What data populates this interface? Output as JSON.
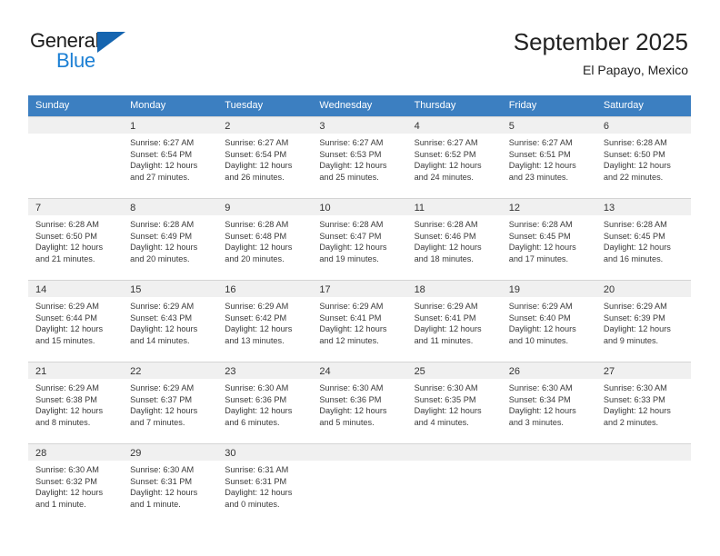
{
  "brand": {
    "name_top": "General",
    "name_bottom": "Blue",
    "triangle_color": "#1565b0",
    "blue_color": "#1b7fd4"
  },
  "header": {
    "title": "September 2025",
    "subtitle": "El Papayo, Mexico"
  },
  "calendar": {
    "header_bg": "#3c7fc1",
    "daynum_bg": "#f0f0f0",
    "weekdays": [
      "Sunday",
      "Monday",
      "Tuesday",
      "Wednesday",
      "Thursday",
      "Friday",
      "Saturday"
    ],
    "weeks": [
      [
        {
          "day": "",
          "empty": true
        },
        {
          "day": "1",
          "sunrise": "Sunrise: 6:27 AM",
          "sunset": "Sunset: 6:54 PM",
          "daylight1": "Daylight: 12 hours",
          "daylight2": "and 27 minutes."
        },
        {
          "day": "2",
          "sunrise": "Sunrise: 6:27 AM",
          "sunset": "Sunset: 6:54 PM",
          "daylight1": "Daylight: 12 hours",
          "daylight2": "and 26 minutes."
        },
        {
          "day": "3",
          "sunrise": "Sunrise: 6:27 AM",
          "sunset": "Sunset: 6:53 PM",
          "daylight1": "Daylight: 12 hours",
          "daylight2": "and 25 minutes."
        },
        {
          "day": "4",
          "sunrise": "Sunrise: 6:27 AM",
          "sunset": "Sunset: 6:52 PM",
          "daylight1": "Daylight: 12 hours",
          "daylight2": "and 24 minutes."
        },
        {
          "day": "5",
          "sunrise": "Sunrise: 6:27 AM",
          "sunset": "Sunset: 6:51 PM",
          "daylight1": "Daylight: 12 hours",
          "daylight2": "and 23 minutes."
        },
        {
          "day": "6",
          "sunrise": "Sunrise: 6:28 AM",
          "sunset": "Sunset: 6:50 PM",
          "daylight1": "Daylight: 12 hours",
          "daylight2": "and 22 minutes."
        }
      ],
      [
        {
          "day": "7",
          "sunrise": "Sunrise: 6:28 AM",
          "sunset": "Sunset: 6:50 PM",
          "daylight1": "Daylight: 12 hours",
          "daylight2": "and 21 minutes."
        },
        {
          "day": "8",
          "sunrise": "Sunrise: 6:28 AM",
          "sunset": "Sunset: 6:49 PM",
          "daylight1": "Daylight: 12 hours",
          "daylight2": "and 20 minutes."
        },
        {
          "day": "9",
          "sunrise": "Sunrise: 6:28 AM",
          "sunset": "Sunset: 6:48 PM",
          "daylight1": "Daylight: 12 hours",
          "daylight2": "and 20 minutes."
        },
        {
          "day": "10",
          "sunrise": "Sunrise: 6:28 AM",
          "sunset": "Sunset: 6:47 PM",
          "daylight1": "Daylight: 12 hours",
          "daylight2": "and 19 minutes."
        },
        {
          "day": "11",
          "sunrise": "Sunrise: 6:28 AM",
          "sunset": "Sunset: 6:46 PM",
          "daylight1": "Daylight: 12 hours",
          "daylight2": "and 18 minutes."
        },
        {
          "day": "12",
          "sunrise": "Sunrise: 6:28 AM",
          "sunset": "Sunset: 6:45 PM",
          "daylight1": "Daylight: 12 hours",
          "daylight2": "and 17 minutes."
        },
        {
          "day": "13",
          "sunrise": "Sunrise: 6:28 AM",
          "sunset": "Sunset: 6:45 PM",
          "daylight1": "Daylight: 12 hours",
          "daylight2": "and 16 minutes."
        }
      ],
      [
        {
          "day": "14",
          "sunrise": "Sunrise: 6:29 AM",
          "sunset": "Sunset: 6:44 PM",
          "daylight1": "Daylight: 12 hours",
          "daylight2": "and 15 minutes."
        },
        {
          "day": "15",
          "sunrise": "Sunrise: 6:29 AM",
          "sunset": "Sunset: 6:43 PM",
          "daylight1": "Daylight: 12 hours",
          "daylight2": "and 14 minutes."
        },
        {
          "day": "16",
          "sunrise": "Sunrise: 6:29 AM",
          "sunset": "Sunset: 6:42 PM",
          "daylight1": "Daylight: 12 hours",
          "daylight2": "and 13 minutes."
        },
        {
          "day": "17",
          "sunrise": "Sunrise: 6:29 AM",
          "sunset": "Sunset: 6:41 PM",
          "daylight1": "Daylight: 12 hours",
          "daylight2": "and 12 minutes."
        },
        {
          "day": "18",
          "sunrise": "Sunrise: 6:29 AM",
          "sunset": "Sunset: 6:41 PM",
          "daylight1": "Daylight: 12 hours",
          "daylight2": "and 11 minutes."
        },
        {
          "day": "19",
          "sunrise": "Sunrise: 6:29 AM",
          "sunset": "Sunset: 6:40 PM",
          "daylight1": "Daylight: 12 hours",
          "daylight2": "and 10 minutes."
        },
        {
          "day": "20",
          "sunrise": "Sunrise: 6:29 AM",
          "sunset": "Sunset: 6:39 PM",
          "daylight1": "Daylight: 12 hours",
          "daylight2": "and 9 minutes."
        }
      ],
      [
        {
          "day": "21",
          "sunrise": "Sunrise: 6:29 AM",
          "sunset": "Sunset: 6:38 PM",
          "daylight1": "Daylight: 12 hours",
          "daylight2": "and 8 minutes."
        },
        {
          "day": "22",
          "sunrise": "Sunrise: 6:29 AM",
          "sunset": "Sunset: 6:37 PM",
          "daylight1": "Daylight: 12 hours",
          "daylight2": "and 7 minutes."
        },
        {
          "day": "23",
          "sunrise": "Sunrise: 6:30 AM",
          "sunset": "Sunset: 6:36 PM",
          "daylight1": "Daylight: 12 hours",
          "daylight2": "and 6 minutes."
        },
        {
          "day": "24",
          "sunrise": "Sunrise: 6:30 AM",
          "sunset": "Sunset: 6:36 PM",
          "daylight1": "Daylight: 12 hours",
          "daylight2": "and 5 minutes."
        },
        {
          "day": "25",
          "sunrise": "Sunrise: 6:30 AM",
          "sunset": "Sunset: 6:35 PM",
          "daylight1": "Daylight: 12 hours",
          "daylight2": "and 4 minutes."
        },
        {
          "day": "26",
          "sunrise": "Sunrise: 6:30 AM",
          "sunset": "Sunset: 6:34 PM",
          "daylight1": "Daylight: 12 hours",
          "daylight2": "and 3 minutes."
        },
        {
          "day": "27",
          "sunrise": "Sunrise: 6:30 AM",
          "sunset": "Sunset: 6:33 PM",
          "daylight1": "Daylight: 12 hours",
          "daylight2": "and 2 minutes."
        }
      ],
      [
        {
          "day": "28",
          "sunrise": "Sunrise: 6:30 AM",
          "sunset": "Sunset: 6:32 PM",
          "daylight1": "Daylight: 12 hours",
          "daylight2": "and 1 minute."
        },
        {
          "day": "29",
          "sunrise": "Sunrise: 6:30 AM",
          "sunset": "Sunset: 6:31 PM",
          "daylight1": "Daylight: 12 hours",
          "daylight2": "and 1 minute."
        },
        {
          "day": "30",
          "sunrise": "Sunrise: 6:31 AM",
          "sunset": "Sunset: 6:31 PM",
          "daylight1": "Daylight: 12 hours",
          "daylight2": "and 0 minutes."
        },
        {
          "day": "",
          "empty": true
        },
        {
          "day": "",
          "empty": true
        },
        {
          "day": "",
          "empty": true
        },
        {
          "day": "",
          "empty": true
        }
      ]
    ]
  }
}
